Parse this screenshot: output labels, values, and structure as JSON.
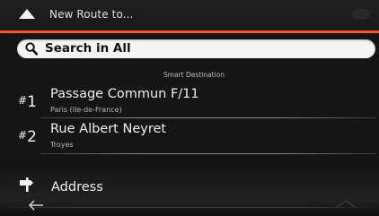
{
  "header": {
    "title": "New Route to..."
  },
  "search": {
    "label": "Search in All"
  },
  "section": {
    "title": "Smart Destination"
  },
  "destinations": [
    {
      "rank_hash": "#",
      "rank_num": "1",
      "name": "Passage Commun F/11",
      "detail": "Paris (Ile-de-France)"
    },
    {
      "rank_hash": "#",
      "rank_num": "2",
      "name": "Rue Albert Neyret",
      "detail": "Troyes"
    }
  ],
  "address": {
    "label": "Address"
  },
  "colors": {
    "accent": "#f05a28",
    "background": "#161616"
  },
  "icons": {
    "back": "back-triangle-icon",
    "search": "search-icon",
    "address": "signpost-icon",
    "nav_back": "left-arrow-icon"
  }
}
